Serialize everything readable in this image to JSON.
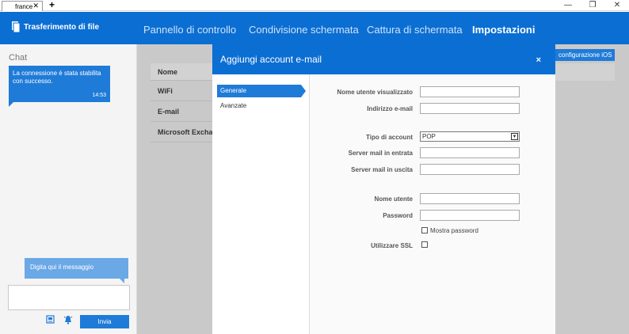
{
  "titlebar": {
    "tab_title": "france",
    "tab_close": "✕",
    "new_tab": "+",
    "minimize": "—",
    "restore": "❐",
    "close": "✕"
  },
  "topnav": {
    "brand": "Trasferimento di file",
    "items": [
      "Pannello di controllo",
      "Condivisione schermata",
      "Cattura di schermata",
      "Impostazioni"
    ],
    "active_index": 3
  },
  "chat": {
    "title": "Chat",
    "message": "La connessione è stata stabilita con successo.",
    "message_time": "14:53",
    "input_hint": "Digita qui il messaggio",
    "send_label": "Invia"
  },
  "background": {
    "table_rows": [
      "Nome",
      "WiFi",
      "E-mail",
      "Microsoft Exchange"
    ],
    "ios_button": "configurazione iOS"
  },
  "modal": {
    "title": "Aggiungi account e-mail",
    "close": "×",
    "tabs": [
      "Generale",
      "Avanzate"
    ],
    "fields": {
      "display_name_label": "Nome utente visualizzato",
      "email_label": "Indirizzo e-mail",
      "account_type_label": "Tipo di account",
      "account_type_value": "POP",
      "incoming_label": "Server mail in entrata",
      "outgoing_label": "Server mail in uscita",
      "username_label": "Nome utente",
      "password_label": "Password",
      "show_password_label": "Mostra password",
      "ssl_label": "Utilizzare SSL"
    }
  },
  "colors": {
    "brand_blue": "#0b6ed3",
    "accent_blue": "#1f7bd8",
    "dim_gray": "#c9c9c9"
  }
}
